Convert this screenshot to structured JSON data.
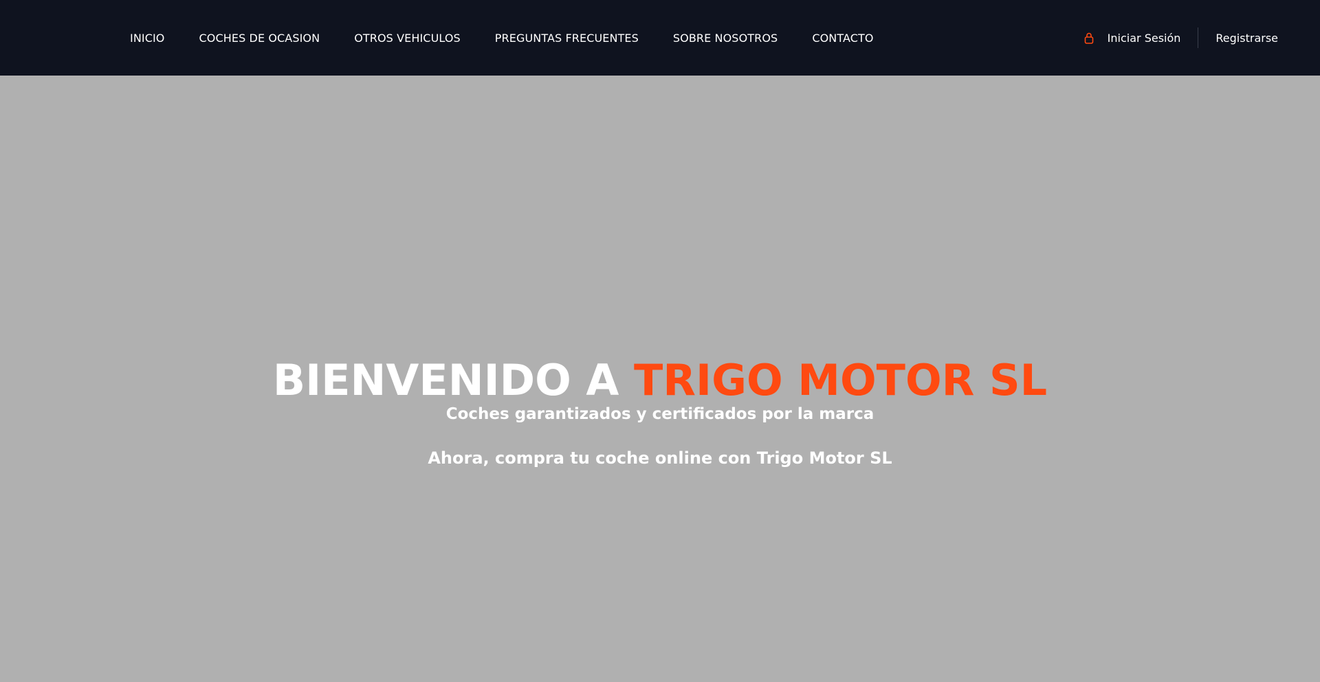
{
  "nav": {
    "items": [
      {
        "label": "INICIO"
      },
      {
        "label": "COCHES DE OCASION"
      },
      {
        "label": "OTROS VEHICULOS"
      },
      {
        "label": "PREGUNTAS FRECUENTES"
      },
      {
        "label": "SOBRE NOSOTROS"
      },
      {
        "label": "CONTACTO"
      }
    ]
  },
  "auth": {
    "login_icon": "lock-icon",
    "login_label": "Iniciar Sesión",
    "register_label": "Registrarse"
  },
  "hero": {
    "title_prefix": "BIENVENIDO A ",
    "title_highlight": "TRIGO MOTOR SL",
    "subtitle": "Coches garantizados y certificados por la marca",
    "tagline": "Ahora, compra tu coche online con Trigo Motor SL"
  },
  "colors": {
    "navbar_bg": "#0f131f",
    "hero_bg": "#b0b0b0",
    "accent": "#ff4a11",
    "text": "#ffffff"
  }
}
